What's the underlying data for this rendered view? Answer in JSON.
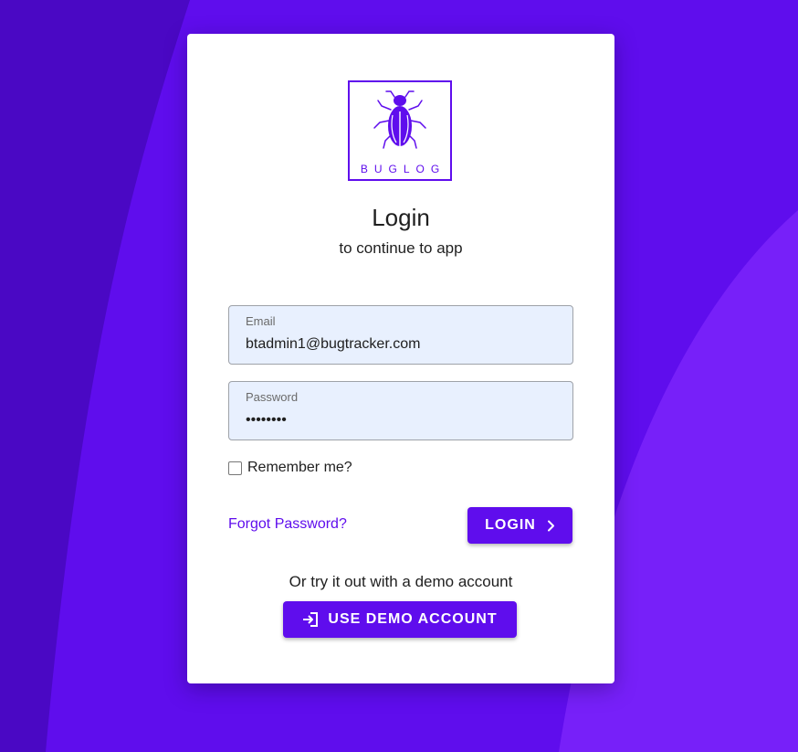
{
  "colors": {
    "accent": "#5f0ded",
    "background_dark": "#4a08c4",
    "background_light": "#7720f9",
    "card": "#ffffff",
    "field_fill": "#e8f0fe"
  },
  "logo": {
    "text": "BUGLOG",
    "icon": "bug-icon"
  },
  "header": {
    "title": "Login",
    "subtitle": "to continue to app"
  },
  "form": {
    "email": {
      "label": "Email",
      "value": "btadmin1@bugtracker.com"
    },
    "password": {
      "label": "Password",
      "value": "********"
    },
    "remember": {
      "label": "Remember me?",
      "checked": false
    }
  },
  "actions": {
    "forgot_label": "Forgot Password?",
    "login_label": "LOGIN",
    "login_icon": "chevron-right-icon",
    "demo_prompt": "Or try it out with a demo account",
    "demo_label": "USE DEMO ACCOUNT",
    "demo_icon": "login-arrow-icon"
  }
}
